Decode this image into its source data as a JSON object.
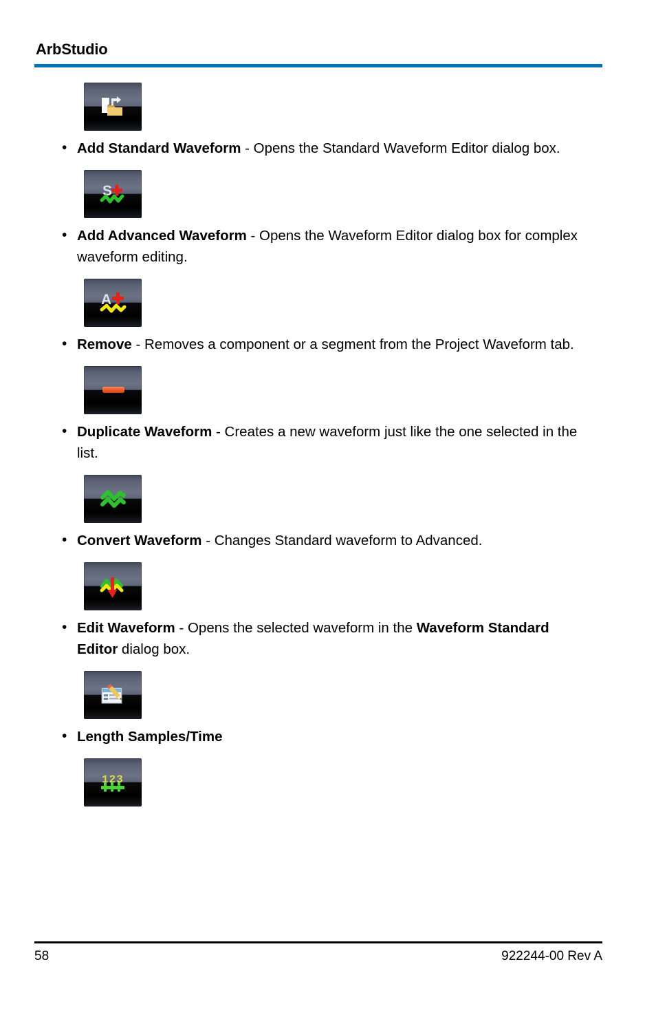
{
  "header": {
    "title": "ArbStudio",
    "rule_color": "#0472b4"
  },
  "footer": {
    "page_number": "58",
    "document_code": "922244-00 Rev A"
  },
  "bullet_char": "•",
  "entries": [
    {
      "icon_name": "add-standard-waveform-icon",
      "icon_kind": "file-folder-arrow",
      "bullet_bold": "Add Standard Waveform",
      "bullet_rest": " - Opens the Standard Waveform Editor dialog box.",
      "bullet_bold_2": "",
      "bullet_rest_2": ""
    },
    {
      "icon_name": "add-advanced-waveform-icon",
      "icon_kind": "s-plus-green-wave",
      "bullet_bold": "Add Advanced Waveform",
      "bullet_rest": " - Opens the Waveform Editor dialog box for complex waveform editing.",
      "bullet_bold_2": "",
      "bullet_rest_2": ""
    },
    {
      "icon_name": "remove-icon",
      "icon_kind": "a-plus-yellow-wave",
      "bullet_bold": "Remove",
      "bullet_rest": " - Removes a component or a segment from the Project Waveform tab.",
      "bullet_bold_2": "",
      "bullet_rest_2": ""
    },
    {
      "icon_name": "duplicate-waveform-icon",
      "icon_kind": "red-minus-bar",
      "bullet_bold": "Duplicate Waveform",
      "bullet_rest": " - Creates a new waveform just like the one selected in the list.",
      "bullet_bold_2": "",
      "bullet_rest_2": ""
    },
    {
      "icon_name": "convert-waveform-icon",
      "icon_kind": "double-green-wave",
      "bullet_bold": "Convert Waveform",
      "bullet_rest": " - Changes Standard waveform to Advanced.",
      "bullet_bold_2": "",
      "bullet_rest_2": ""
    },
    {
      "icon_name": "edit-waveform-icon",
      "icon_kind": "green-yellow-wave-red-arrow",
      "bullet_bold": "Edit Waveform",
      "bullet_rest": " - Opens the selected waveform in the ",
      "bullet_bold_2": "Waveform Standard Editor",
      "bullet_rest_2": " dialog box."
    },
    {
      "icon_name": "length-samples-time-icon",
      "icon_kind": "document-pencil",
      "bullet_bold": "Length Samples/Time",
      "bullet_rest": "",
      "bullet_bold_2": "",
      "bullet_rest_2": ""
    },
    {
      "icon_name": "numeric-length-icon",
      "icon_kind": "digits-123-ruler",
      "bullet_bold": "",
      "bullet_rest": "",
      "bullet_bold_2": "",
      "bullet_rest_2": ""
    }
  ],
  "icon_colors": {
    "folder": "#e8c46a",
    "page_white": "#f4f5f7",
    "green_wave": "#2fbf2f",
    "yellow_wave": "#f2e619",
    "red_plus": "#e32219",
    "red_bar": "#f26a3c",
    "pencil": "#e8c46a",
    "digits": "#d9d94a",
    "ruler_green": "#4bd43a"
  }
}
